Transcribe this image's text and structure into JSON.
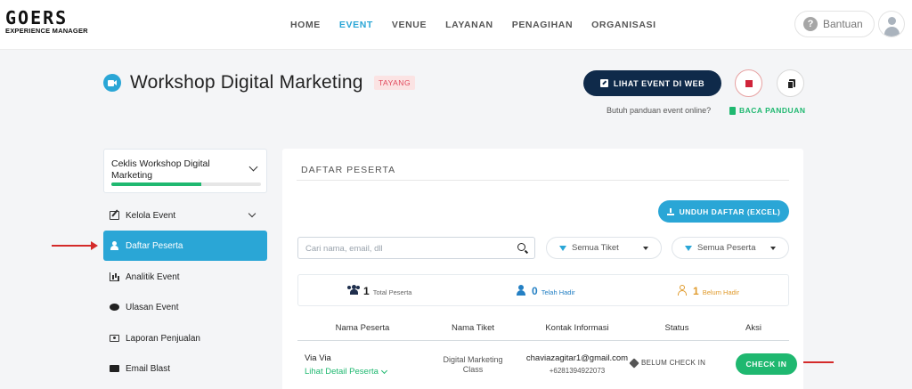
{
  "header": {
    "logo_main": "GOERS",
    "logo_sub": "EXPERIENCE MANAGER",
    "nav": [
      "HOME",
      "EVENT",
      "VENUE",
      "LAYANAN",
      "PENAGIHAN",
      "ORGANISASI"
    ],
    "active_nav": "EVENT",
    "help_label": "Bantuan"
  },
  "event": {
    "title": "Workshop Digital Marketing",
    "status_badge": "TAYANG",
    "view_web_label": "LIHAT EVENT DI WEB",
    "guide_question": "Butuh panduan event online?",
    "guide_link": "BACA PANDUAN"
  },
  "sidebar": {
    "checklist_title": "Ceklis Workshop Digital Marketing",
    "checklist_progress": 0.6,
    "items": [
      {
        "label": "Kelola Event",
        "icon": "edit-icon"
      },
      {
        "label": "Daftar Peserta",
        "icon": "users-icon"
      },
      {
        "label": "Analitik Event",
        "icon": "chart-icon"
      },
      {
        "label": "Ulasan Event",
        "icon": "comment-icon"
      },
      {
        "label": "Laporan Penjualan",
        "icon": "money-icon"
      },
      {
        "label": "Email Blast",
        "icon": "mail-icon"
      }
    ],
    "active_item": "Daftar Peserta"
  },
  "main": {
    "section_title": "DAFTAR PESERTA",
    "download_label": "UNDUH DAFTAR (EXCEL)",
    "search_placeholder": "Cari nama, email, dll",
    "filter_ticket": "Semua Tiket",
    "filter_participant": "Semua Peserta",
    "stats": [
      {
        "value": "1",
        "label": "Total Peserta"
      },
      {
        "value": "0",
        "label": "Telah Hadir"
      },
      {
        "value": "1",
        "label": "Belum Hadir"
      }
    ],
    "columns": [
      "Nama Peserta",
      "Nama Tiket",
      "Kontak Informasi",
      "Status",
      "Aksi"
    ],
    "rows": [
      {
        "name": "Via Via",
        "detail_link": "Lihat Detail Peserta",
        "ticket_line1": "Digital Marketing",
        "ticket_line2": "Class",
        "email": "chaviazagitar1@gmail.com",
        "phone": "+6281394922073",
        "status": "BELUM CHECK IN",
        "action": "CHECK IN"
      }
    ]
  },
  "colors": {
    "accent": "#2aa6d6",
    "navy": "#0f2a4a",
    "success": "#1fb870",
    "danger": "#d0243a",
    "annotation_arrow": "#d42a2a"
  }
}
